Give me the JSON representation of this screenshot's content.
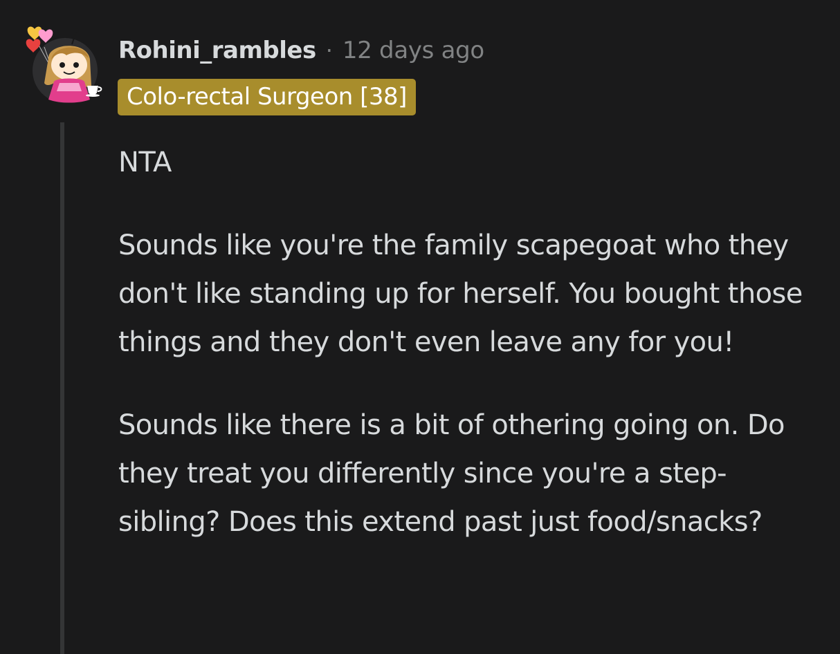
{
  "comment": {
    "username": "Rohini_rambles",
    "separator": "·",
    "timestamp": "12 days ago",
    "flair": "Colo-rectal Surgeon [38]",
    "flair_color": "#a88d2c",
    "avatar_icon": "snoo-avatar-with-heart-balloons",
    "paragraphs": [
      "NTA",
      "Sounds like you're the family scapegoat who they don't like standing up for herself. You bought those things and they don't even leave any for you!",
      "Sounds like there is a bit of othering going on. Do they treat you differently since you're a step-sibling? Does this extend past just food/snacks?"
    ]
  }
}
